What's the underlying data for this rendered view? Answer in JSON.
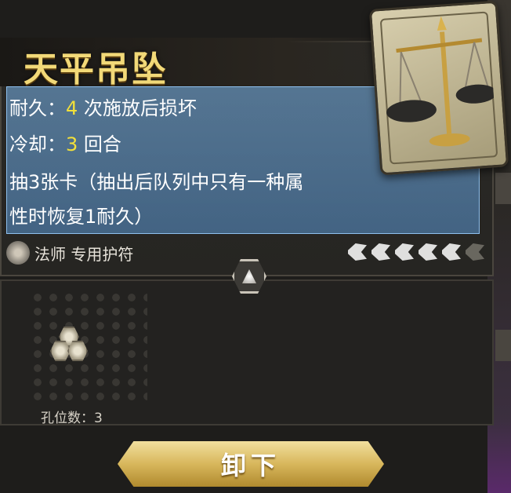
{
  "item": {
    "name": "天平吊坠",
    "durability_label": "耐久：",
    "durability_value": "4",
    "durability_suffix": " 次施放后损坏",
    "cooldown_label": "冷却：",
    "cooldown_value": "3",
    "cooldown_suffix": " 回合",
    "effect_line1": "抽3张卡（抽出后队列中只有一种属",
    "effect_line2": "性时恢复1耐久）",
    "class_text": "法师 专用护符",
    "rarity_stars": 5,
    "rarity_max": 6
  },
  "sockets": {
    "count_text": "孔位数：3"
  },
  "actions": {
    "unload_label": "卸下"
  },
  "colors": {
    "title": "#f2d978",
    "highlight": "#f2e03a",
    "description_bg": "#6fa7dd",
    "button_gold": "#d8b75c"
  },
  "icons": {
    "class": "mage-emblem-icon",
    "star": "rarity-star-icon",
    "badge": "hex-gem-icon",
    "socket": "socket-gem-icon",
    "card": "balance-scale-icon"
  }
}
